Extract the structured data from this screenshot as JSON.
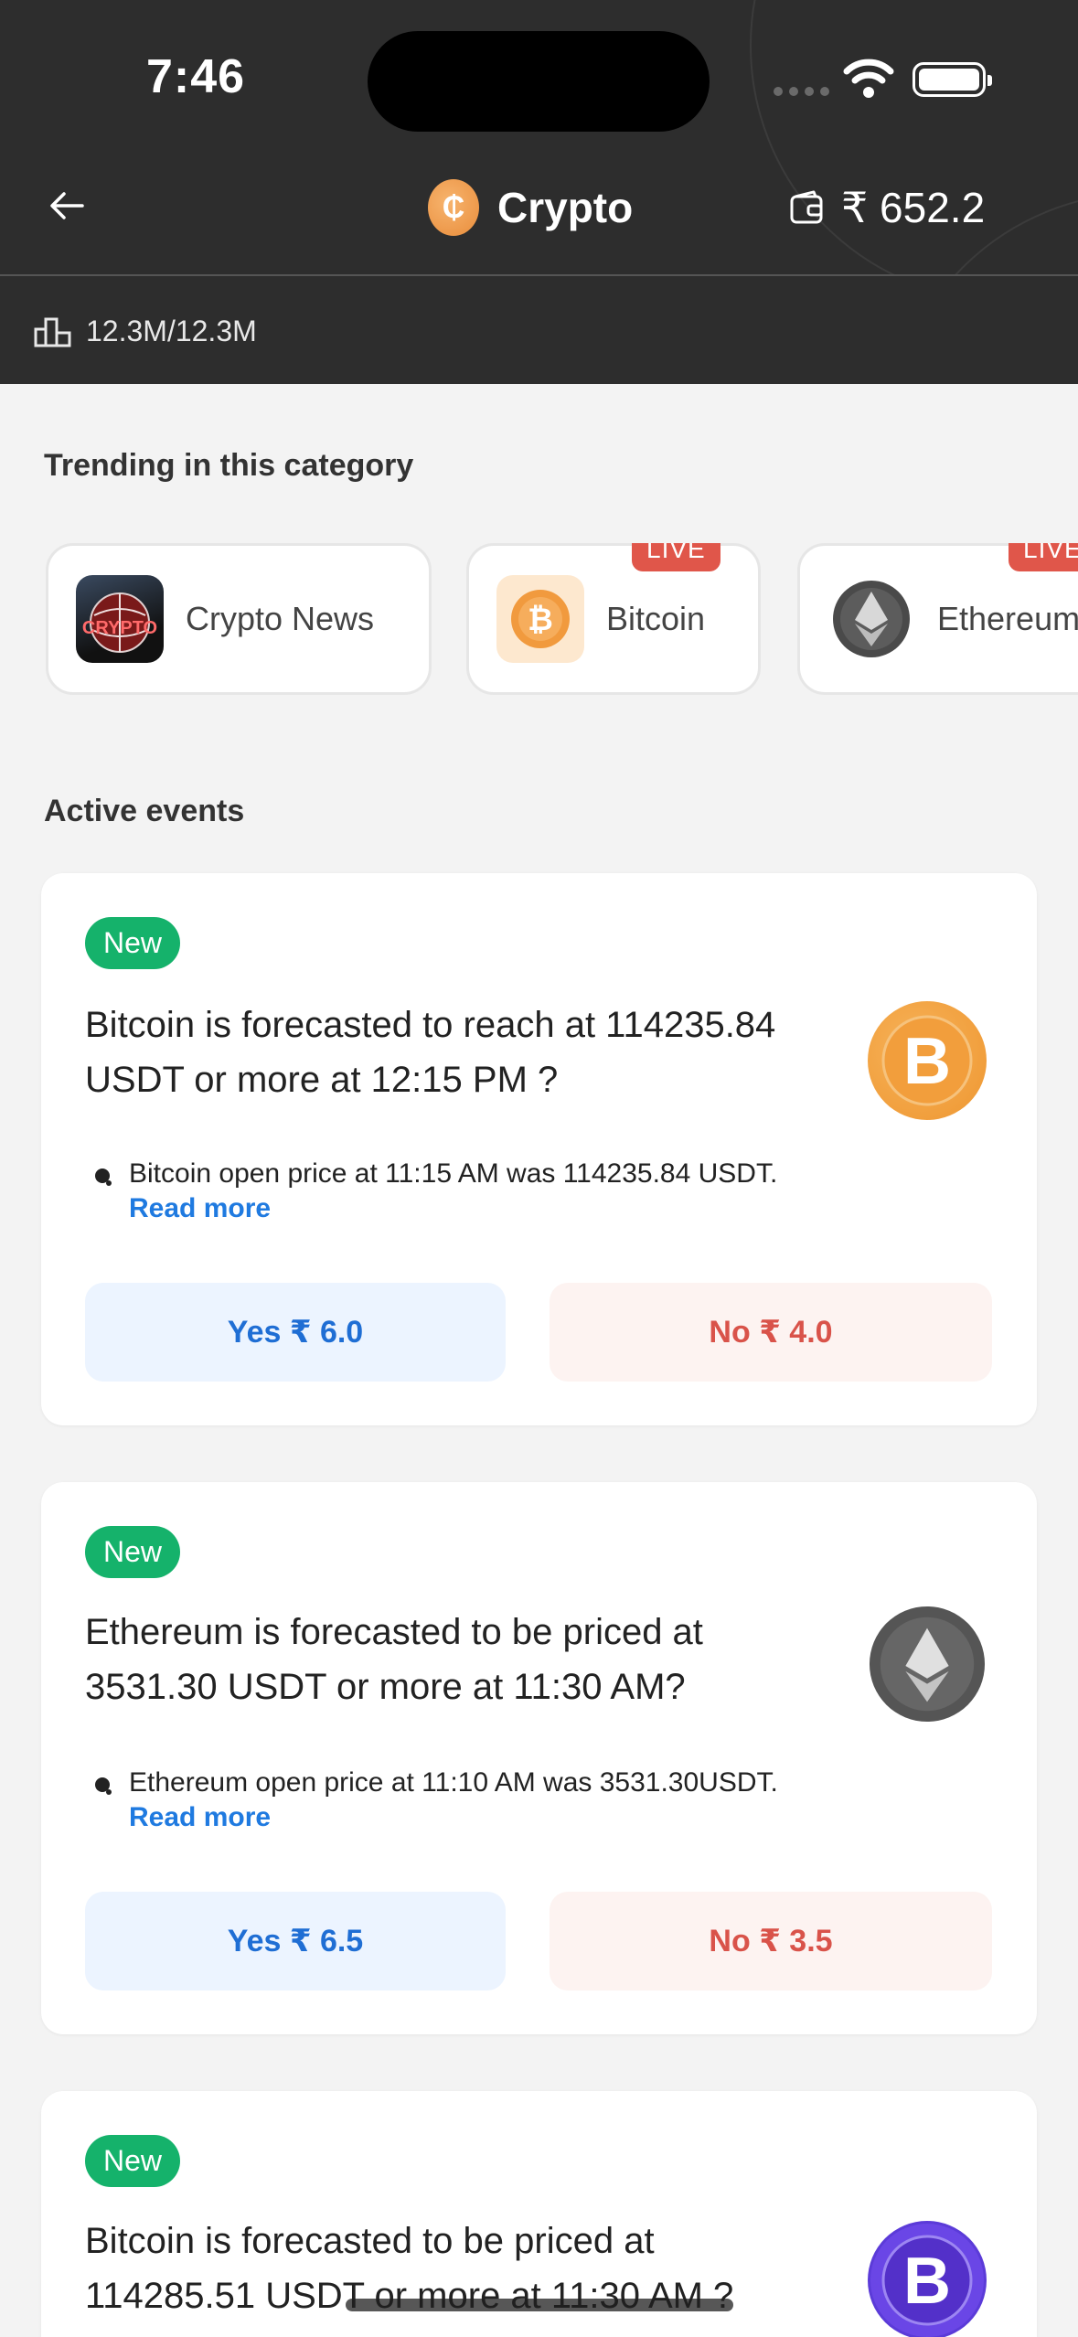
{
  "status": {
    "time": "7:46"
  },
  "header": {
    "title": "Crypto",
    "wallet": "₹ 652.2",
    "volume": "12.3M/12.3M",
    "coin_symbol": "₵"
  },
  "trending": {
    "title": "Trending in this category",
    "items": [
      {
        "label": "Crypto News",
        "live": "",
        "img_text": "CRYPTO"
      },
      {
        "label": "Bitcoin",
        "live": "LIVE"
      },
      {
        "label": "Ethereum",
        "live": "LIVE"
      }
    ]
  },
  "active": {
    "title": "Active events",
    "events": [
      {
        "badge": "New",
        "question": "Bitcoin is forecasted to reach at 114235.84 USDT or more at 12:15 PM ?",
        "info": "Bitcoin open price at 11:15 AM was 114235.84 USDT.",
        "read_more": "Read more",
        "yes": "Yes ₹ 6.0",
        "no": "No ₹ 4.0",
        "coin_symbol": "B"
      },
      {
        "badge": "New",
        "question": "Ethereum is forecasted to be priced at 3531.30 USDT or more at 11:30 AM?",
        "info": "Ethereum open price at 11:10 AM was 3531.30USDT.",
        "read_more": "Read more",
        "yes": "Yes ₹ 6.5",
        "no": "No ₹ 3.5"
      },
      {
        "badge": "New",
        "question": "Bitcoin is forecasted to be priced at 114285.51 USDT or more at 11:30 AM ?",
        "coin_symbol": "B"
      }
    ]
  },
  "colors": {
    "accent_blue": "#1f7ae0",
    "green": "#15b26b",
    "live_red": "#e0564a",
    "header_bg": "#2d2d2d"
  }
}
